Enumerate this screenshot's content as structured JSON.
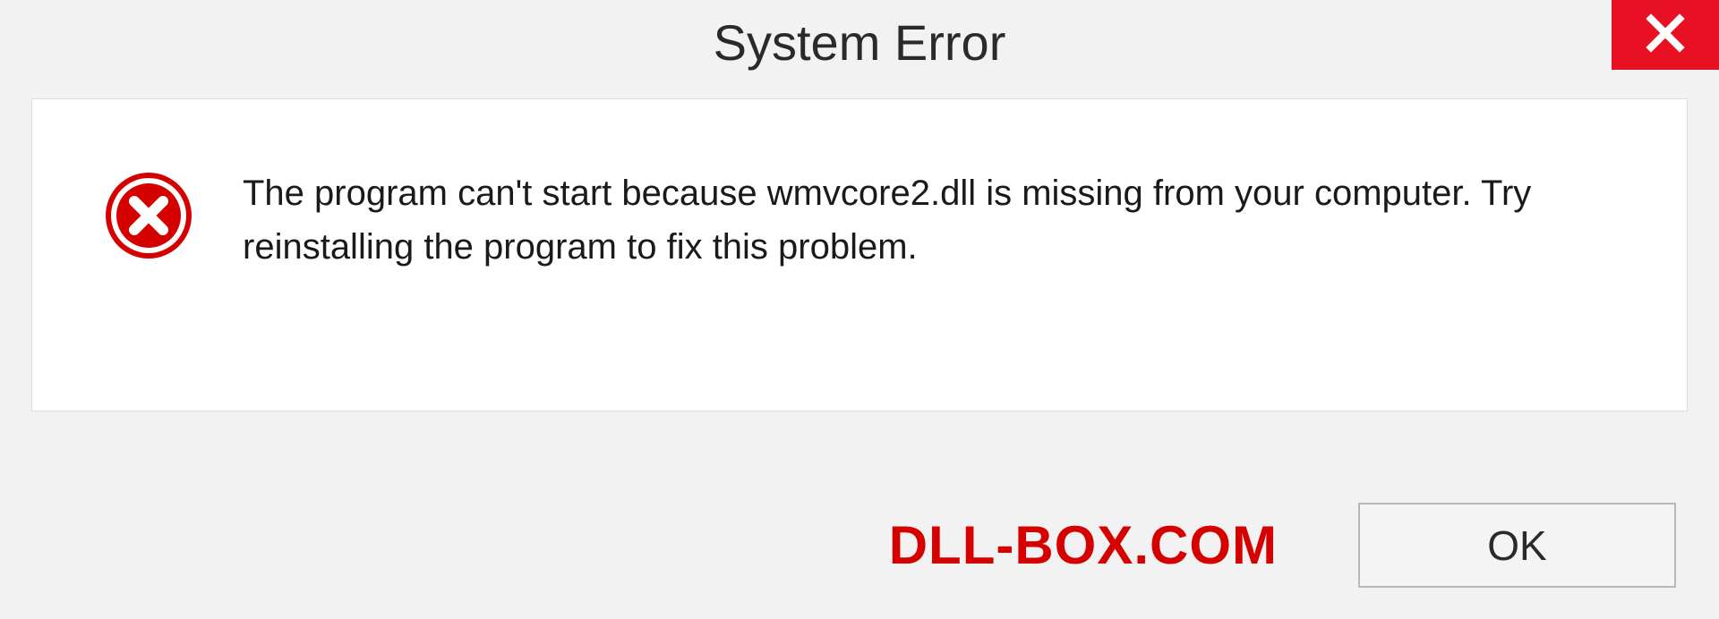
{
  "dialog": {
    "title": "System Error",
    "message": "The program can't start because wmvcore2.dll is missing from your computer. Try reinstalling the program to fix this problem.",
    "ok_label": "OK"
  },
  "watermark": "DLL-BOX.COM"
}
